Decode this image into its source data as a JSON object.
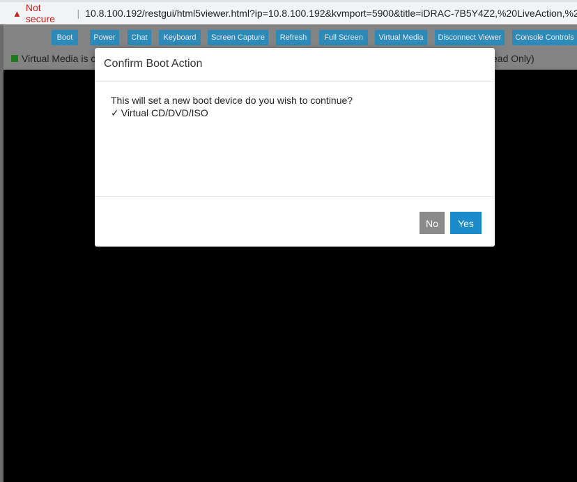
{
  "browser": {
    "security_label": "Not secure",
    "separator": "|",
    "url": "10.8.100.192/restgui/html5viewer.html?ip=10.8.100.192&kvmport=5900&title=iDRAC-7B5Y4Z2,%20LiveAction,%20..."
  },
  "toolbar": {
    "buttons": [
      "Boot",
      "Power",
      "Chat",
      "Keyboard",
      "Screen Capture",
      "Refresh",
      "Full Screen",
      "Virtual Media",
      "Disconnect Viewer",
      "Console Controls"
    ]
  },
  "status": {
    "left_text": "Virtual Media is co",
    "right_text": "ead Only)",
    "indicator_color": "#1e7c1e"
  },
  "modal": {
    "title": "Confirm Boot Action",
    "message": "This will set a new boot device do you wish to continue?",
    "option_check": "✓",
    "option": "Virtual CD/DVD/ISO",
    "no_label": "No",
    "yes_label": "Yes"
  },
  "colors": {
    "toolbar_button": "#2d89b8",
    "yes_button": "#1a8ccc",
    "no_button": "#8a8a8a"
  }
}
